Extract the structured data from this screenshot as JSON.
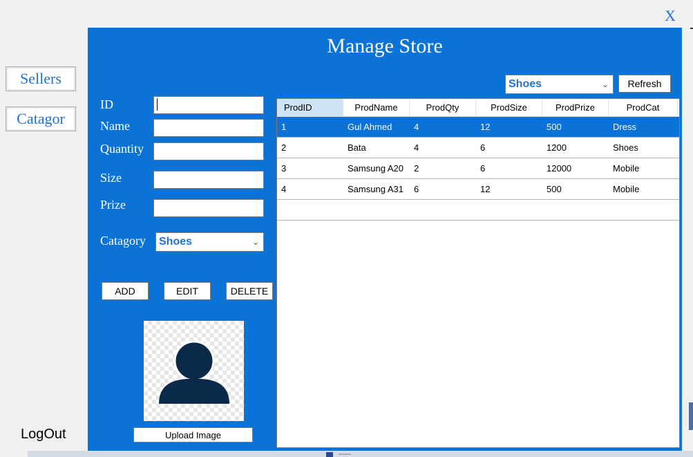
{
  "window": {
    "close_label": "X"
  },
  "nav": {
    "sellers": "Sellers",
    "catagor": "Catagor",
    "logout": "LogOut"
  },
  "panel": {
    "title": "Manage Store",
    "filter": {
      "selected": "Shoes"
    },
    "refresh_label": "Refresh",
    "form": {
      "id_label": "ID",
      "name_label": "Name",
      "quantity_label": "Quantity",
      "size_label": "Size",
      "prize_label": "Prize",
      "category_label": "Catagory",
      "category_selected": "Shoes",
      "id_value": "",
      "name_value": "",
      "quantity_value": "",
      "size_value": "",
      "prize_value": ""
    },
    "buttons": {
      "add": "ADD",
      "edit": "EDIT",
      "delete": "DELETE",
      "upload": "Upload Image"
    },
    "table": {
      "columns": [
        "ProdID",
        "ProdName",
        "ProdQty",
        "ProdSize",
        "ProdPrize",
        "ProdCat"
      ],
      "rows": [
        [
          "1",
          "Gul Ahmed",
          "4",
          "12",
          "500",
          "Dress"
        ],
        [
          "2",
          "Bata",
          "4",
          "6",
          "1200",
          "Shoes"
        ],
        [
          "3",
          "Samsung A20",
          "2",
          "6",
          "12000",
          "Mobile"
        ],
        [
          "4",
          "Samsung A31",
          "6",
          "12",
          "500",
          "Mobile"
        ]
      ],
      "selected_row": 0
    }
  },
  "colors": {
    "panel": "#0b73d6",
    "accent": "#1f73d6",
    "avatar": "#0b2a4a"
  }
}
